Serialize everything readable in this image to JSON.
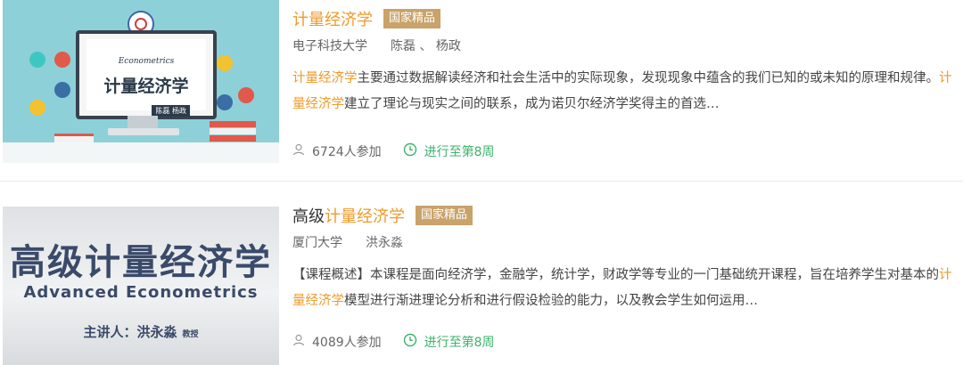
{
  "courses": [
    {
      "title_plain": "",
      "title_highlight": "计量经济学",
      "badge": "国家精品",
      "school": "电子科技大学",
      "teachers": "陈磊 、 杨政",
      "desc": [
        {
          "t": "计量经济学",
          "hl": true
        },
        {
          "t": "主要通过数据解读经济和社会生活中的实际现象，发现现象中蕴含的我们已知的或未知的原理和规律。",
          "hl": false
        },
        {
          "t": "计量经济学",
          "hl": true
        },
        {
          "t": "建立了理论与现实之间的联系，成为诺贝尔经济学奖得主的首选…",
          "hl": false
        }
      ],
      "participants": "6724人参加",
      "progress": "进行至第8周",
      "thumb": {
        "econ": "Econometrics",
        "cn": "计量经济学",
        "names": "陈磊 杨政"
      }
    },
    {
      "title_plain": "高级",
      "title_highlight": "计量经济学",
      "badge": "国家精品",
      "school": "厦门大学",
      "teachers": "洪永淼",
      "desc": [
        {
          "t": "【课程概述】本课程是面向经济学，金融学，统计学，财政学等专业的一门基础统开课程，旨在培养学生对基本的",
          "hl": false
        },
        {
          "t": "计量经济学",
          "hl": true
        },
        {
          "t": "模型进行渐进理论分析和进行假设检验的能力，以及教会学生如何运用…",
          "hl": false
        }
      ],
      "participants": "4089人参加",
      "progress": "进行至第8周",
      "thumb": {
        "cn": "高级计量经济学",
        "en": "Advanced Econometrics",
        "speaker": "主讲人：洪永淼",
        "rank": "教授"
      }
    }
  ],
  "icons": {
    "participants": "user-icon",
    "progress": "clock-icon"
  },
  "colors": {
    "highlight": "#f09a2a",
    "badge": "#c9a36a",
    "progress": "#3db36b"
  }
}
